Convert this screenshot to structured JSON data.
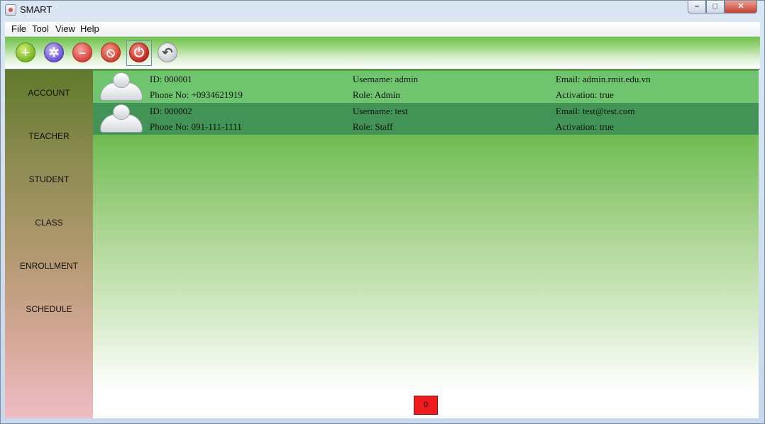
{
  "window": {
    "title": "SMART"
  },
  "menu": [
    "File",
    "Tool",
    "View",
    "Help"
  ],
  "toolbar": {
    "buttons": [
      {
        "icon": "plus-icon"
      },
      {
        "icon": "gear-icon"
      },
      {
        "icon": "minus-icon"
      },
      {
        "icon": "block-icon"
      },
      {
        "icon": "power-icon"
      },
      {
        "icon": "undo-icon"
      }
    ]
  },
  "sidebar": {
    "items": [
      {
        "label": "ACCOUNT"
      },
      {
        "label": "TEACHER"
      },
      {
        "label": "STUDENT"
      },
      {
        "label": "CLASS"
      },
      {
        "label": "ENROLLMENT"
      },
      {
        "label": "SCHEDULE"
      }
    ]
  },
  "accounts": [
    {
      "id": "ID: 000001",
      "phone": "Phone No: +0934621919",
      "username": "Username: admin",
      "role": "Role: Admin",
      "email": "Email: admin.rmit.edu.vn",
      "activation": "Activation: true"
    },
    {
      "id": "ID: 000002",
      "phone": "Phone No: 091-111-1111",
      "username": "Username: test",
      "role": "Role: Staff",
      "email": "Email: test@test.com",
      "activation": "Activation: true"
    }
  ],
  "footer": {
    "counter": "0"
  },
  "colors": {
    "row_selected": "#6fc46e",
    "row_alt": "#429456",
    "counter": "#ee1c1c"
  }
}
